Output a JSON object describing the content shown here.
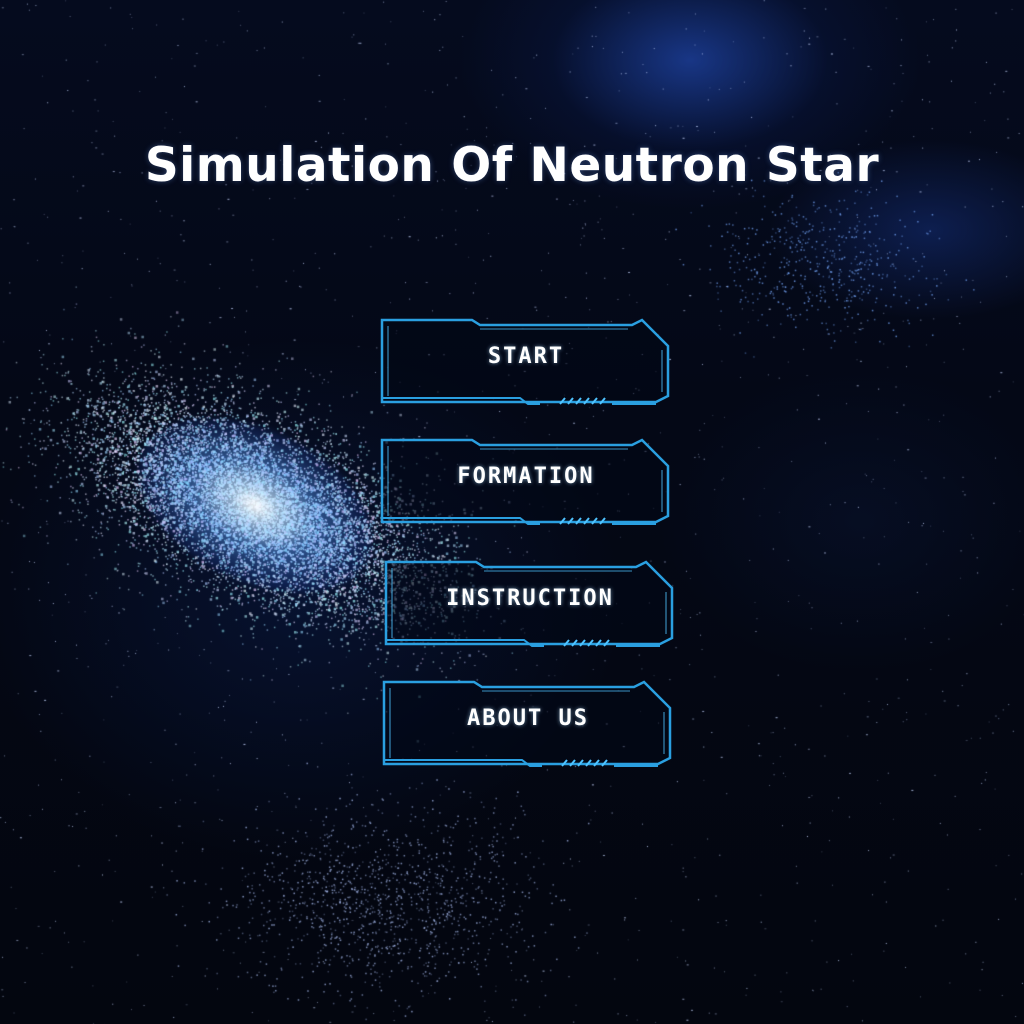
{
  "screen": {
    "title": "Simulation Of Neutron Star"
  },
  "menu": {
    "items": [
      {
        "id": "start",
        "label": "START"
      },
      {
        "id": "formation",
        "label": "FORMATION"
      },
      {
        "id": "instruction",
        "label": "INSTRUCTION"
      },
      {
        "id": "about",
        "label": "ABOUT US"
      }
    ]
  },
  "theme": {
    "frame_color": "#2a9fe0",
    "frame_glow": "#4fc3ff",
    "text_color": "#ffffff",
    "space_color": "#040816"
  },
  "icons": {
    "button_frame": "sci-fi-frame-icon"
  }
}
